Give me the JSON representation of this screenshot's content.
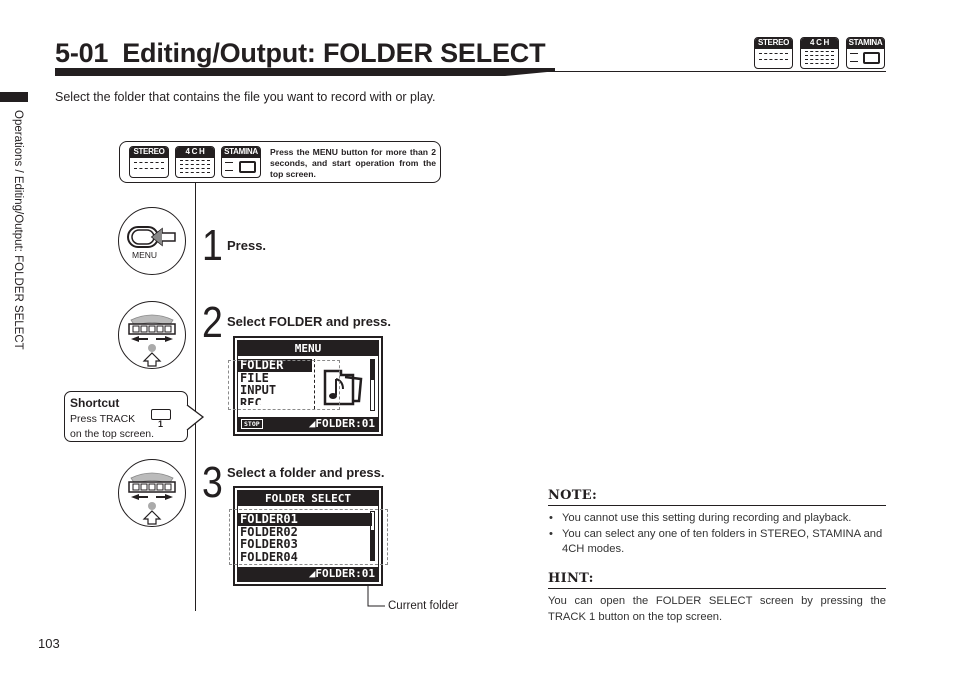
{
  "header": {
    "section_number": "5-01",
    "title": "Editing/Output: FOLDER SELECT",
    "intro": "Select the folder that contains the file you want to record with or play."
  },
  "mode_badges": [
    {
      "label": "STEREO",
      "icon": "stereo-mode-icon"
    },
    {
      "label": "4 C H",
      "icon": "4ch-mode-icon"
    },
    {
      "label": "STAMINA",
      "icon": "stamina-mode-icon"
    }
  ],
  "side_label": "Operations / Editing/Output: FOLDER SELECT",
  "operation_hint": {
    "text": "Press the MENU button for more than 2 seconds, and start operation from the top screen."
  },
  "steps": [
    {
      "number": "1",
      "text": "Press.",
      "icon": "menu-button-icon",
      "icon_label": "MENU"
    },
    {
      "number": "2",
      "text": "Select FOLDER and press.",
      "icon": "dial-wheel-icon"
    },
    {
      "number": "3",
      "text": "Select a folder and press.",
      "icon": "dial-wheel-icon"
    }
  ],
  "menu_screen": {
    "header": "MENU",
    "items": [
      "FOLDER",
      "FILE",
      "INPUT",
      "REC"
    ],
    "selected_index": 0,
    "status": "STOP",
    "footer": "FOLDER:01"
  },
  "folder_screen": {
    "header": "FOLDER SELECT",
    "items": [
      "FOLDER01",
      "FOLDER02",
      "FOLDER03",
      "FOLDER04"
    ],
    "selected_index": 0,
    "footer": "FOLDER:01",
    "callout": "Current folder"
  },
  "shortcut": {
    "title": "Shortcut",
    "line1": "Press  TRACK",
    "button_number": "1",
    "line2": "on the top screen."
  },
  "note": {
    "heading": "NOTE:",
    "items": [
      "You cannot use this setting during recording and playback.",
      "You can select any one of ten folders in STEREO, STAMINA and 4CH modes."
    ]
  },
  "hint": {
    "heading": "HINT:",
    "text": "You can open the FOLDER SELECT screen by pressing the TRACK 1 button on the top screen."
  },
  "page_number": "103"
}
